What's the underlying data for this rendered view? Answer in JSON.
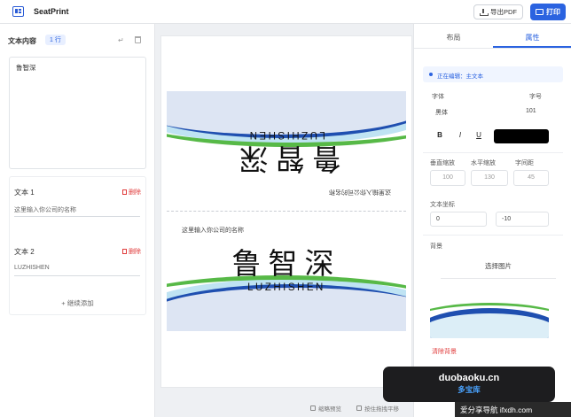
{
  "app": {
    "title": "SeatPrint"
  },
  "header": {
    "export_pdf": "导出PDF",
    "print": "打印"
  },
  "left_panel": {
    "heading": "文本内容",
    "row_badge": "1 行",
    "textarea_value": "鲁智深",
    "texts": [
      {
        "label": "文本 1",
        "delete": "删除",
        "value": "这里输入你公司的名称"
      },
      {
        "label": "文本 2",
        "delete": "删除",
        "value": "LUZHISHEN"
      }
    ],
    "add_text": "+ 继续添加"
  },
  "card": {
    "company": "这里输入你公司的名称",
    "name": "鲁智深",
    "pinyin": "LUZHISHEN"
  },
  "bottom_bar": {
    "hint1": "缩略预览",
    "hint2": "按住拖拽平移"
  },
  "right_panel": {
    "tabs": [
      {
        "label": "布局"
      },
      {
        "label": "属性"
      }
    ],
    "editing": "正在编辑：主文本",
    "font_label": "字体",
    "size_label": "字号",
    "font_value": "黑体",
    "size_value": "101",
    "style_bold": "B",
    "style_italic": "I",
    "style_underline": "U",
    "vertical_scale_label": "垂直缩放",
    "horizontal_scale_label": "水平缩放",
    "spacing_label": "字间距",
    "vertical_scale_value": "100",
    "horizontal_scale_value": "130",
    "spacing_value": "45",
    "position_label": "文本坐标",
    "pos_x": "0",
    "pos_y": "-10",
    "background_label": "背景",
    "choose_image": "选择图片",
    "clear_background": "清除背景"
  },
  "watermark": {
    "line1": "duobaoku.cn",
    "line2": "多宝库",
    "strip": "爱分享导航 ifxdh.com"
  },
  "colors": {
    "accent": "#2b63e0",
    "danger": "#e03b3b",
    "card_blue": "#1f4fb0",
    "card_green": "#57b947"
  }
}
